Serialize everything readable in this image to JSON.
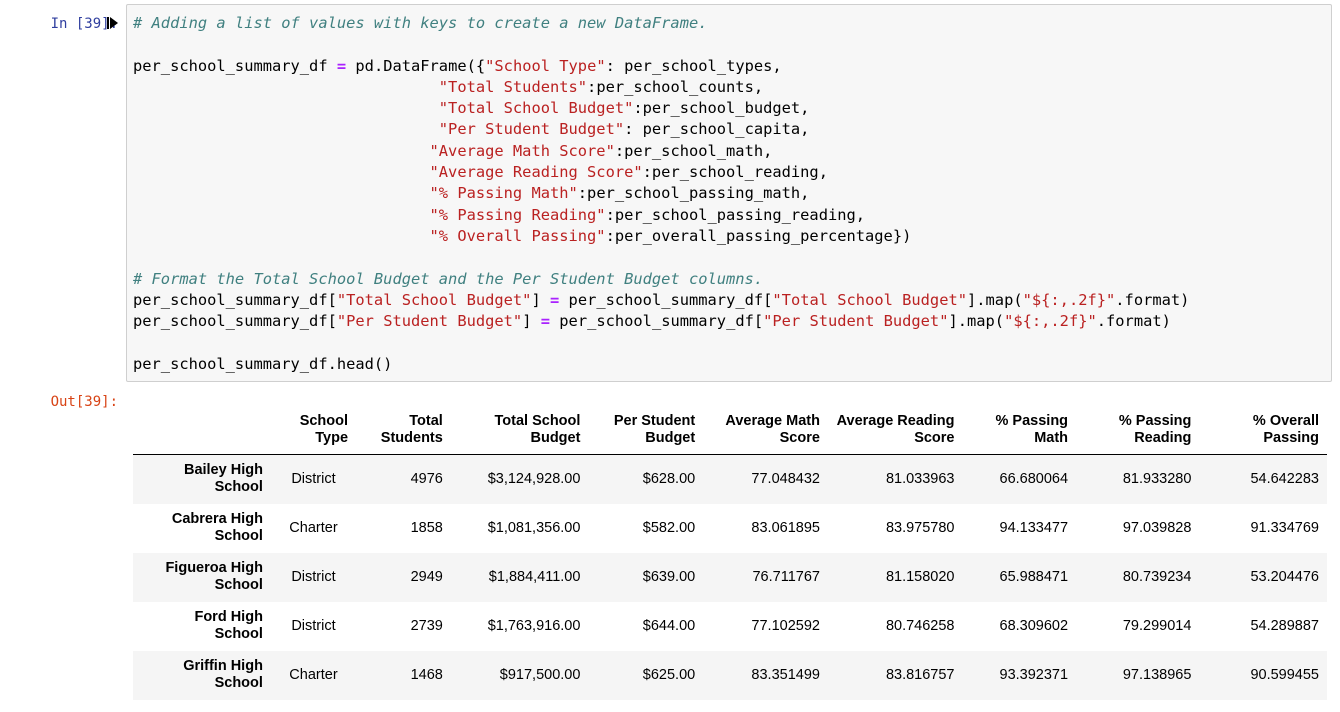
{
  "prompts": {
    "input": "In [39]:",
    "output": "Out[39]:"
  },
  "code": {
    "comment1": "# Adding a list of values with keys to create a new DataFrame.",
    "comment2": "# Format the Total School Budget and the Per Student Budget columns."
  },
  "dataframe": {
    "columns": [
      "School Type",
      "Total Students",
      "Total School Budget",
      "Per Student Budget",
      "Average Math Score",
      "Average Reading Score",
      "% Passing Math",
      "% Passing Reading",
      "% Overall Passing"
    ],
    "header_lines": [
      [
        "School",
        "Type"
      ],
      [
        "Total",
        "Students"
      ],
      [
        "Total School",
        "Budget"
      ],
      [
        "Per Student",
        "Budget"
      ],
      [
        "Average Math",
        "Score"
      ],
      [
        "Average Reading",
        "Score"
      ],
      [
        "% Passing",
        "Math"
      ],
      [
        "% Passing",
        "Reading"
      ],
      [
        "% Overall",
        "Passing"
      ]
    ],
    "rows": [
      {
        "index": [
          "Bailey High",
          "School"
        ],
        "values": [
          "District",
          "4976",
          "$3,124,928.00",
          "$628.00",
          "77.048432",
          "81.033963",
          "66.680064",
          "81.933280",
          "54.642283"
        ]
      },
      {
        "index": [
          "Cabrera High",
          "School"
        ],
        "values": [
          "Charter",
          "1858",
          "$1,081,356.00",
          "$582.00",
          "83.061895",
          "83.975780",
          "94.133477",
          "97.039828",
          "91.334769"
        ]
      },
      {
        "index": [
          "Figueroa High",
          "School"
        ],
        "values": [
          "District",
          "2949",
          "$1,884,411.00",
          "$639.00",
          "76.711767",
          "81.158020",
          "65.988471",
          "80.739234",
          "53.204476"
        ]
      },
      {
        "index": [
          "Ford High",
          "School"
        ],
        "values": [
          "District",
          "2739",
          "$1,763,916.00",
          "$644.00",
          "77.102592",
          "80.746258",
          "68.309602",
          "79.299014",
          "54.289887"
        ]
      },
      {
        "index": [
          "Griffin High",
          "School"
        ],
        "values": [
          "Charter",
          "1468",
          "$917,500.00",
          "$625.00",
          "83.351499",
          "83.816757",
          "93.392371",
          "97.138965",
          "90.599455"
        ]
      }
    ]
  },
  "colors": {
    "input_prompt": "#303f9f",
    "output_prompt": "#d84315",
    "comment": "#408080",
    "string": "#ba2121",
    "operator": "#aa22ff",
    "cell_background": "#f7f7f7",
    "stripe": "#f5f5f5"
  },
  "icons": {
    "run": "run-cell-icon"
  }
}
